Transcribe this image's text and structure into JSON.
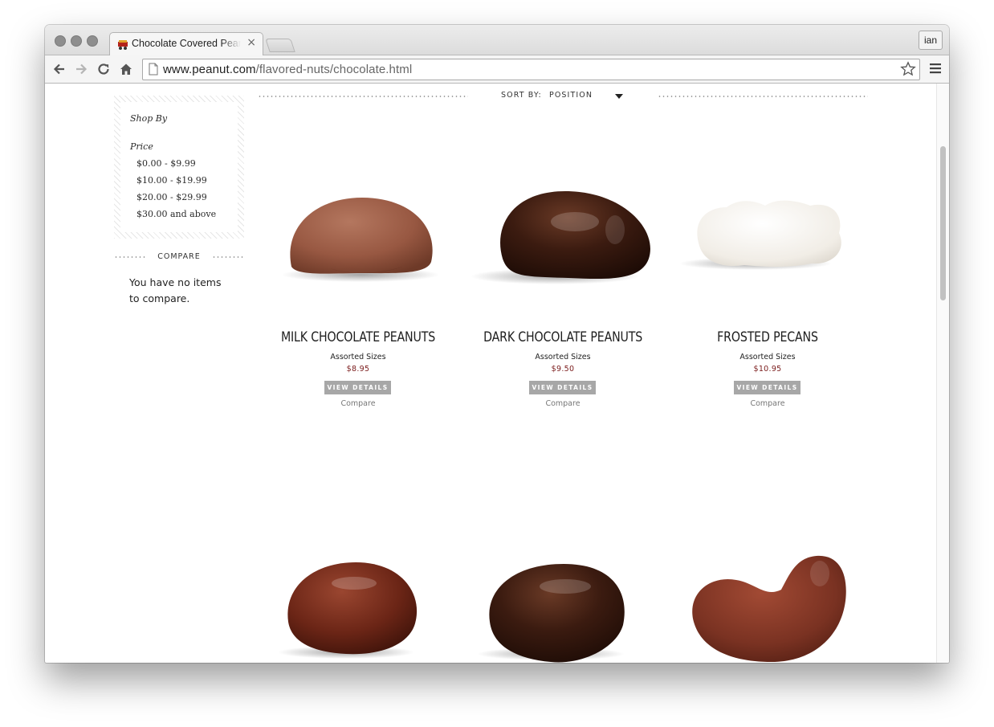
{
  "browser": {
    "tab_title": "Chocolate Covered Peanuts",
    "tab_close": "×",
    "profile_label": "ian",
    "url_host": "www.peanut.com",
    "url_path": "/flavored-nuts/chocolate.html"
  },
  "sidebar": {
    "shop_by_title": "Shop By",
    "price_heading": "Price",
    "price_ranges": [
      "$0.00 - $9.99",
      "$10.00 - $19.99",
      "$20.00 - $29.99",
      "$30.00 and above"
    ],
    "compare_heading": "COMPARE",
    "compare_message": "You have no items to compare."
  },
  "sort": {
    "label": "SORT BY:",
    "selected": "POSITION"
  },
  "products": [
    {
      "name": "MILK CHOCOLATE PEANUTS",
      "sizes": "Assorted Sizes",
      "price": "$8.95",
      "button": "VIEW DETAILS",
      "compare": "Compare"
    },
    {
      "name": "DARK CHOCOLATE PEANUTS",
      "sizes": "Assorted Sizes",
      "price": "$9.50",
      "button": "VIEW DETAILS",
      "compare": "Compare"
    },
    {
      "name": "FROSTED PECANS",
      "sizes": "Assorted Sizes",
      "price": "$10.95",
      "button": "VIEW DETAILS",
      "compare": "Compare"
    }
  ],
  "colors": {
    "price": "#7a1b1b",
    "button_bg": "#a7a7a7",
    "milk_chocolate": "#9a5a43",
    "dark_chocolate": "#3a1a10",
    "frosted": "#f3f0ea",
    "chocolate_almond": "#6b2516",
    "chocolate_cashew": "#7a3222"
  },
  "icons": {
    "back": "arrow-left-icon",
    "forward": "arrow-right-icon",
    "reload": "reload-icon",
    "home": "home-icon",
    "bookmark": "star-icon",
    "menu": "hamburger-menu-icon",
    "sort": "caret-down-icon"
  }
}
